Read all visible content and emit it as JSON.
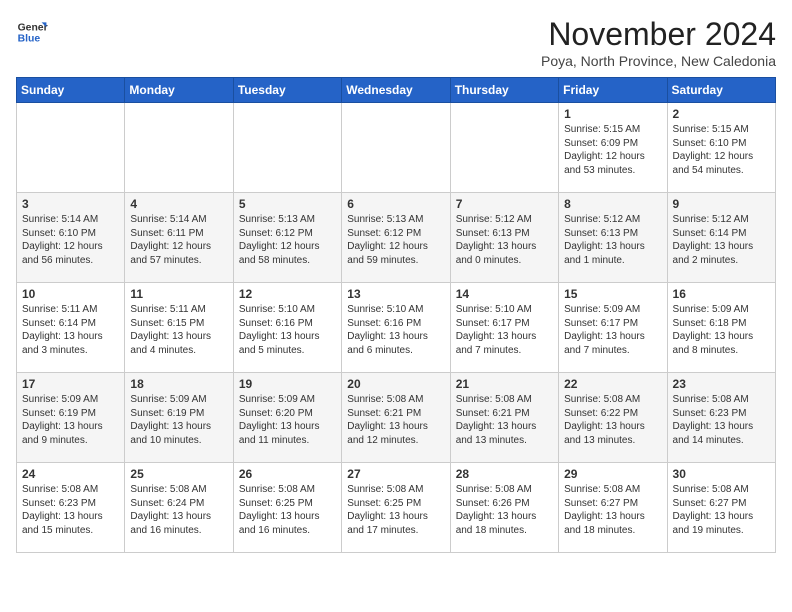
{
  "logo": {
    "line1": "General",
    "line2": "Blue"
  },
  "title": "November 2024",
  "subtitle": "Poya, North Province, New Caledonia",
  "weekdays": [
    "Sunday",
    "Monday",
    "Tuesday",
    "Wednesday",
    "Thursday",
    "Friday",
    "Saturday"
  ],
  "weeks": [
    [
      {
        "day": "",
        "info": ""
      },
      {
        "day": "",
        "info": ""
      },
      {
        "day": "",
        "info": ""
      },
      {
        "day": "",
        "info": ""
      },
      {
        "day": "",
        "info": ""
      },
      {
        "day": "1",
        "info": "Sunrise: 5:15 AM\nSunset: 6:09 PM\nDaylight: 12 hours\nand 53 minutes."
      },
      {
        "day": "2",
        "info": "Sunrise: 5:15 AM\nSunset: 6:10 PM\nDaylight: 12 hours\nand 54 minutes."
      }
    ],
    [
      {
        "day": "3",
        "info": "Sunrise: 5:14 AM\nSunset: 6:10 PM\nDaylight: 12 hours\nand 56 minutes."
      },
      {
        "day": "4",
        "info": "Sunrise: 5:14 AM\nSunset: 6:11 PM\nDaylight: 12 hours\nand 57 minutes."
      },
      {
        "day": "5",
        "info": "Sunrise: 5:13 AM\nSunset: 6:12 PM\nDaylight: 12 hours\nand 58 minutes."
      },
      {
        "day": "6",
        "info": "Sunrise: 5:13 AM\nSunset: 6:12 PM\nDaylight: 12 hours\nand 59 minutes."
      },
      {
        "day": "7",
        "info": "Sunrise: 5:12 AM\nSunset: 6:13 PM\nDaylight: 13 hours\nand 0 minutes."
      },
      {
        "day": "8",
        "info": "Sunrise: 5:12 AM\nSunset: 6:13 PM\nDaylight: 13 hours\nand 1 minute."
      },
      {
        "day": "9",
        "info": "Sunrise: 5:12 AM\nSunset: 6:14 PM\nDaylight: 13 hours\nand 2 minutes."
      }
    ],
    [
      {
        "day": "10",
        "info": "Sunrise: 5:11 AM\nSunset: 6:14 PM\nDaylight: 13 hours\nand 3 minutes."
      },
      {
        "day": "11",
        "info": "Sunrise: 5:11 AM\nSunset: 6:15 PM\nDaylight: 13 hours\nand 4 minutes."
      },
      {
        "day": "12",
        "info": "Sunrise: 5:10 AM\nSunset: 6:16 PM\nDaylight: 13 hours\nand 5 minutes."
      },
      {
        "day": "13",
        "info": "Sunrise: 5:10 AM\nSunset: 6:16 PM\nDaylight: 13 hours\nand 6 minutes."
      },
      {
        "day": "14",
        "info": "Sunrise: 5:10 AM\nSunset: 6:17 PM\nDaylight: 13 hours\nand 7 minutes."
      },
      {
        "day": "15",
        "info": "Sunrise: 5:09 AM\nSunset: 6:17 PM\nDaylight: 13 hours\nand 7 minutes."
      },
      {
        "day": "16",
        "info": "Sunrise: 5:09 AM\nSunset: 6:18 PM\nDaylight: 13 hours\nand 8 minutes."
      }
    ],
    [
      {
        "day": "17",
        "info": "Sunrise: 5:09 AM\nSunset: 6:19 PM\nDaylight: 13 hours\nand 9 minutes."
      },
      {
        "day": "18",
        "info": "Sunrise: 5:09 AM\nSunset: 6:19 PM\nDaylight: 13 hours\nand 10 minutes."
      },
      {
        "day": "19",
        "info": "Sunrise: 5:09 AM\nSunset: 6:20 PM\nDaylight: 13 hours\nand 11 minutes."
      },
      {
        "day": "20",
        "info": "Sunrise: 5:08 AM\nSunset: 6:21 PM\nDaylight: 13 hours\nand 12 minutes."
      },
      {
        "day": "21",
        "info": "Sunrise: 5:08 AM\nSunset: 6:21 PM\nDaylight: 13 hours\nand 13 minutes."
      },
      {
        "day": "22",
        "info": "Sunrise: 5:08 AM\nSunset: 6:22 PM\nDaylight: 13 hours\nand 13 minutes."
      },
      {
        "day": "23",
        "info": "Sunrise: 5:08 AM\nSunset: 6:23 PM\nDaylight: 13 hours\nand 14 minutes."
      }
    ],
    [
      {
        "day": "24",
        "info": "Sunrise: 5:08 AM\nSunset: 6:23 PM\nDaylight: 13 hours\nand 15 minutes."
      },
      {
        "day": "25",
        "info": "Sunrise: 5:08 AM\nSunset: 6:24 PM\nDaylight: 13 hours\nand 16 minutes."
      },
      {
        "day": "26",
        "info": "Sunrise: 5:08 AM\nSunset: 6:25 PM\nDaylight: 13 hours\nand 16 minutes."
      },
      {
        "day": "27",
        "info": "Sunrise: 5:08 AM\nSunset: 6:25 PM\nDaylight: 13 hours\nand 17 minutes."
      },
      {
        "day": "28",
        "info": "Sunrise: 5:08 AM\nSunset: 6:26 PM\nDaylight: 13 hours\nand 18 minutes."
      },
      {
        "day": "29",
        "info": "Sunrise: 5:08 AM\nSunset: 6:27 PM\nDaylight: 13 hours\nand 18 minutes."
      },
      {
        "day": "30",
        "info": "Sunrise: 5:08 AM\nSunset: 6:27 PM\nDaylight: 13 hours\nand 19 minutes."
      }
    ]
  ]
}
